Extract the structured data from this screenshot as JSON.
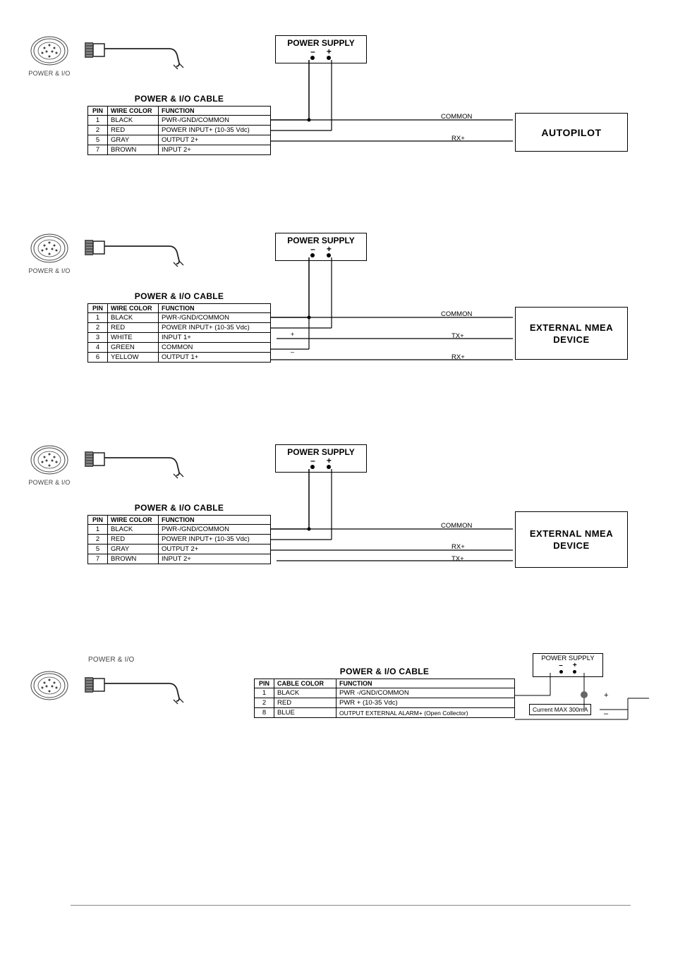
{
  "common": {
    "connector_label": "POWER & I/O",
    "table_title": "POWER & I/O CABLE",
    "power_supply_label": "POWER SUPPLY",
    "col_pin": "PIN",
    "col_wire": "WIRE COLOR",
    "col_cable": "CABLE COLOR",
    "col_func": "FUNCTION",
    "minus": "–",
    "plus": "+"
  },
  "section1": {
    "device": "AUTOPILOT",
    "signals": {
      "s1": "COMMON",
      "s2": "RX+"
    },
    "rows": [
      {
        "pin": "1",
        "color": "BLACK",
        "func": "PWR-/GND/COMMON"
      },
      {
        "pin": "2",
        "color": "RED",
        "func": "POWER INPUT+ (10-35 Vdc)"
      },
      {
        "pin": "5",
        "color": "GRAY",
        "func": "OUTPUT 2+"
      },
      {
        "pin": "7",
        "color": "BROWN",
        "func": "INPUT 2+"
      }
    ]
  },
  "section2": {
    "device": "EXTERNAL NMEA DEVICE",
    "signals": {
      "s1": "COMMON",
      "s2": "TX+",
      "s3": "RX+"
    },
    "rows": [
      {
        "pin": "1",
        "color": "BLACK",
        "func": "PWR-/GND/COMMON"
      },
      {
        "pin": "2",
        "color": "RED",
        "func": "POWER INPUT+ (10-35 Vdc)"
      },
      {
        "pin": "3",
        "color": "WHITE",
        "func": "INPUT 1+"
      },
      {
        "pin": "4",
        "color": "GREEN",
        "func": "COMMON"
      },
      {
        "pin": "6",
        "color": "YELLOW",
        "func": "OUTPUT 1+"
      }
    ]
  },
  "section3": {
    "device": "EXTERNAL NMEA DEVICE",
    "signals": {
      "s1": "COMMON",
      "s2": "RX+",
      "s3": "TX+"
    },
    "rows": [
      {
        "pin": "1",
        "color": "BLACK",
        "func": "PWR-/GND/COMMON"
      },
      {
        "pin": "2",
        "color": "RED",
        "func": "POWER INPUT+ (10-35 Vdc)"
      },
      {
        "pin": "5",
        "color": "GRAY",
        "func": "OUTPUT 2+"
      },
      {
        "pin": "7",
        "color": "BROWN",
        "func": "INPUT 2+"
      }
    ]
  },
  "section4": {
    "current_note": "Current MAX 300mA",
    "rows": [
      {
        "pin": "1",
        "color": "BLACK",
        "func": "PWR -/GND/COMMON"
      },
      {
        "pin": "2",
        "color": "RED",
        "func": "PWR + (10-35 Vdc)"
      },
      {
        "pin": "8",
        "color": "BLUE",
        "func": "OUTPUT EXTERNAL ALARM+ (Open Collector)"
      }
    ]
  }
}
